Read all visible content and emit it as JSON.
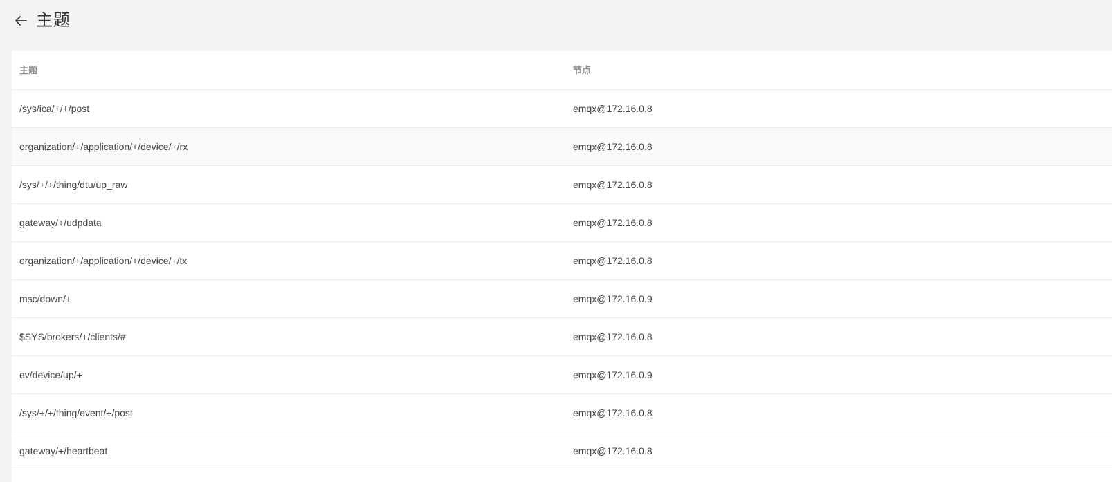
{
  "header": {
    "title": "主题",
    "back_icon": "arrow-left-icon"
  },
  "table": {
    "columns": [
      "主题",
      "节点"
    ],
    "rows": [
      {
        "topic": "/sys/ica/+/+/post",
        "node": "emqx@172.16.0.8"
      },
      {
        "topic": "organization/+/application/+/device/+/rx",
        "node": "emqx@172.16.0.8"
      },
      {
        "topic": "/sys/+/+/thing/dtu/up_raw",
        "node": "emqx@172.16.0.8"
      },
      {
        "topic": "gateway/+/udpdata",
        "node": "emqx@172.16.0.8"
      },
      {
        "topic": "organization/+/application/+/device/+/tx",
        "node": "emqx@172.16.0.8"
      },
      {
        "topic": "msc/down/+",
        "node": "emqx@172.16.0.9"
      },
      {
        "topic": "$SYS/brokers/+/clients/#",
        "node": "emqx@172.16.0.8"
      },
      {
        "topic": "ev/device/up/+",
        "node": "emqx@172.16.0.9"
      },
      {
        "topic": "/sys/+/+/thing/event/+/post",
        "node": "emqx@172.16.0.8"
      },
      {
        "topic": "gateway/+/heartbeat",
        "node": "emqx@172.16.0.8"
      }
    ]
  }
}
